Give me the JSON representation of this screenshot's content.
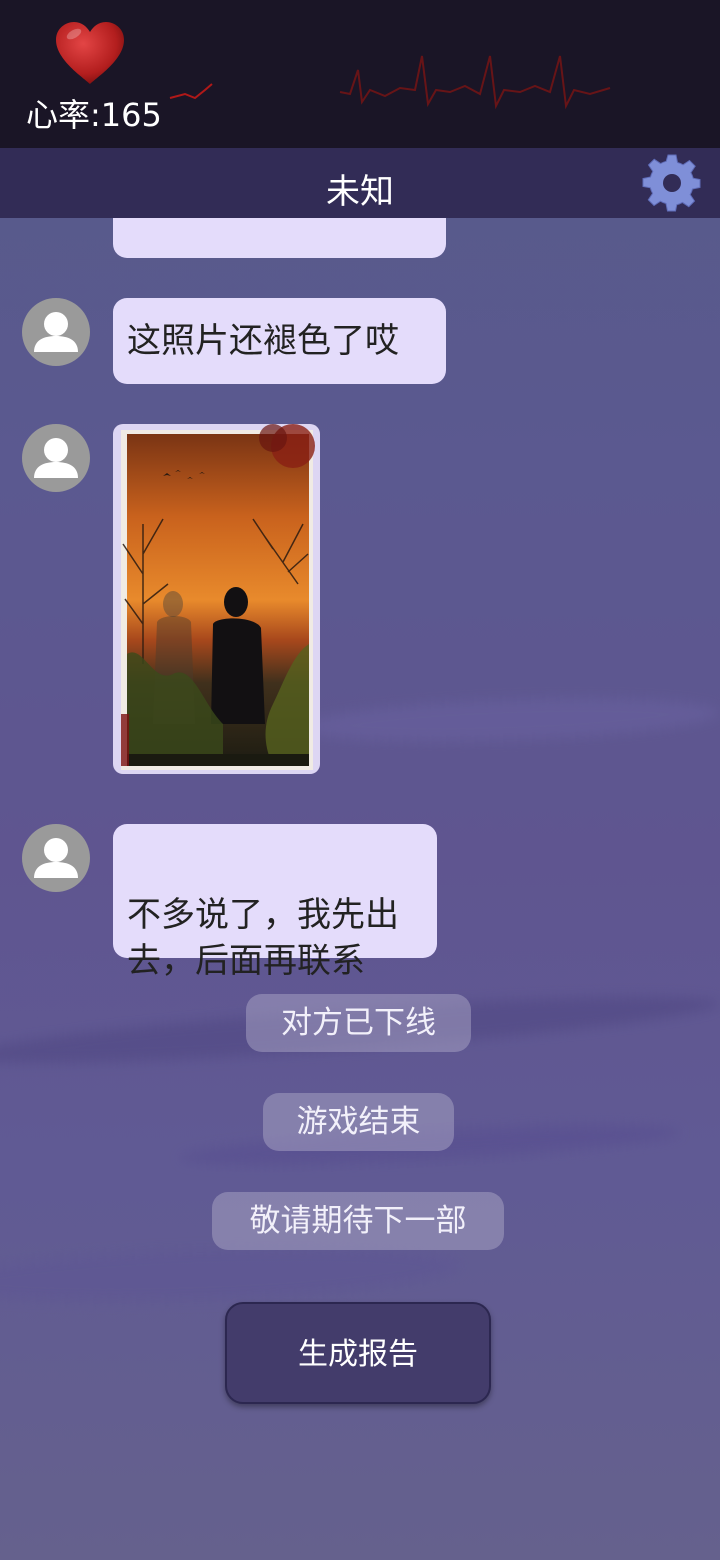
{
  "status": {
    "heart_rate_label": "心率:165"
  },
  "header": {
    "title": "未知"
  },
  "messages": [
    {
      "type": "text",
      "text": "这照片还褪色了哎"
    },
    {
      "type": "image",
      "description_icon": "photo"
    },
    {
      "type": "text",
      "text": "不多说了，我先出\n去，后面再联系"
    }
  ],
  "system_notices": [
    "对方已下线",
    "游戏结束",
    "敬请期待下一部"
  ],
  "actions": {
    "report_label": "生成报告"
  },
  "colors": {
    "bubble": "#e4dcfb",
    "topbar": "#1a1526",
    "titlebar": "#322c56",
    "report_button": "#433c6b",
    "heart": "#c42a2a",
    "gear": "#7f8fd8"
  }
}
